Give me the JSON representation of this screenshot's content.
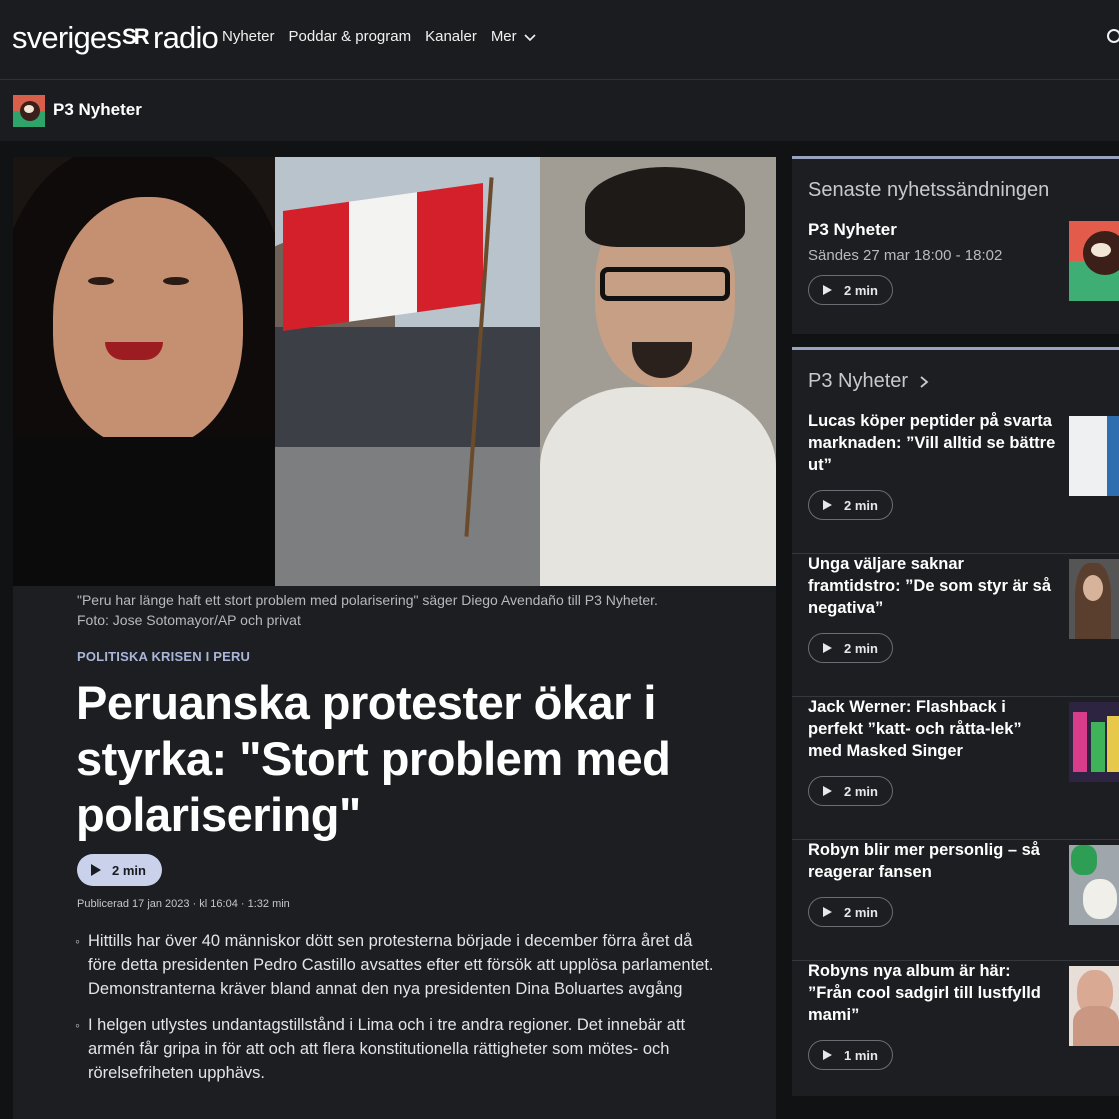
{
  "header": {
    "logo_left": "sveriges",
    "logo_mark": "SR",
    "logo_right": "radio",
    "nav": [
      "Nyheter",
      "Poddar & program",
      "Kanaler",
      "Mer"
    ]
  },
  "program_bar": {
    "title": "P3 Nyheter"
  },
  "article": {
    "caption": "\"Peru har länge haft ett stort problem med polarisering\" säger Diego Avendaño till P3 Nyheter. Foto: Jose Sotomayor/AP och privat",
    "kicker": "POLITISKA KRISEN I PERU",
    "headline": "Peruanska protester ökar i styrka: \"Stort problem med polarisering\"",
    "play_label": "2 min",
    "published": "Publicerad 17 jan 2023 · kl 16:04 · 1:32 min",
    "bullets": [
      "Hittills har över 40 människor dött sen protesterna började i december förra året då före detta presidenten Pedro Castillo avsattes efter ett försök att upplösa parlamentet. Demonstranterna kräver bland annat den nya presidenten Dina Boluartes avgång",
      "I helgen utlystes undantagstillstånd i Lima och i tre andra regioner. Det innebär att armén får gripa in för att och att flera konstitutionella rättigheter som mötes- och rörelsefriheten upphävs."
    ]
  },
  "latest": {
    "heading": "Senaste nyhetssändningen",
    "title": "P3 Nyheter",
    "subtitle": "Sändes 27 mar 18:00 - 18:02",
    "play_label": "2 min"
  },
  "program_list": {
    "heading": "P3 Nyheter",
    "items": [
      {
        "title": "Lucas köper peptider på svarta marknaden: ”Vill alltid se bättre ut”",
        "play_label": "2 min"
      },
      {
        "title": "Unga väljare saknar framtidstro: ”De som styr är så negativa”",
        "play_label": "2 min"
      },
      {
        "title": "Jack Werner: Flashback i perfekt ”katt- och råtta-lek” med Masked Singer",
        "play_label": "2 min"
      },
      {
        "title": "Robyn blir mer personlig – så reagerar fansen",
        "play_label": "2 min"
      },
      {
        "title": "Robyns nya album är här: ”Från cool sadgirl till lustfylld mami”",
        "play_label": "1 min"
      }
    ]
  },
  "colors": {
    "page_bg": "#111214",
    "bar_bg": "#1b1c1f",
    "card_bg": "#1d1e21",
    "accent": "#c9d2ea",
    "kicker": "#a9b6d8"
  },
  "icons": [
    "search-icon",
    "chevron-down-icon",
    "chevron-right-icon",
    "play-icon"
  ]
}
